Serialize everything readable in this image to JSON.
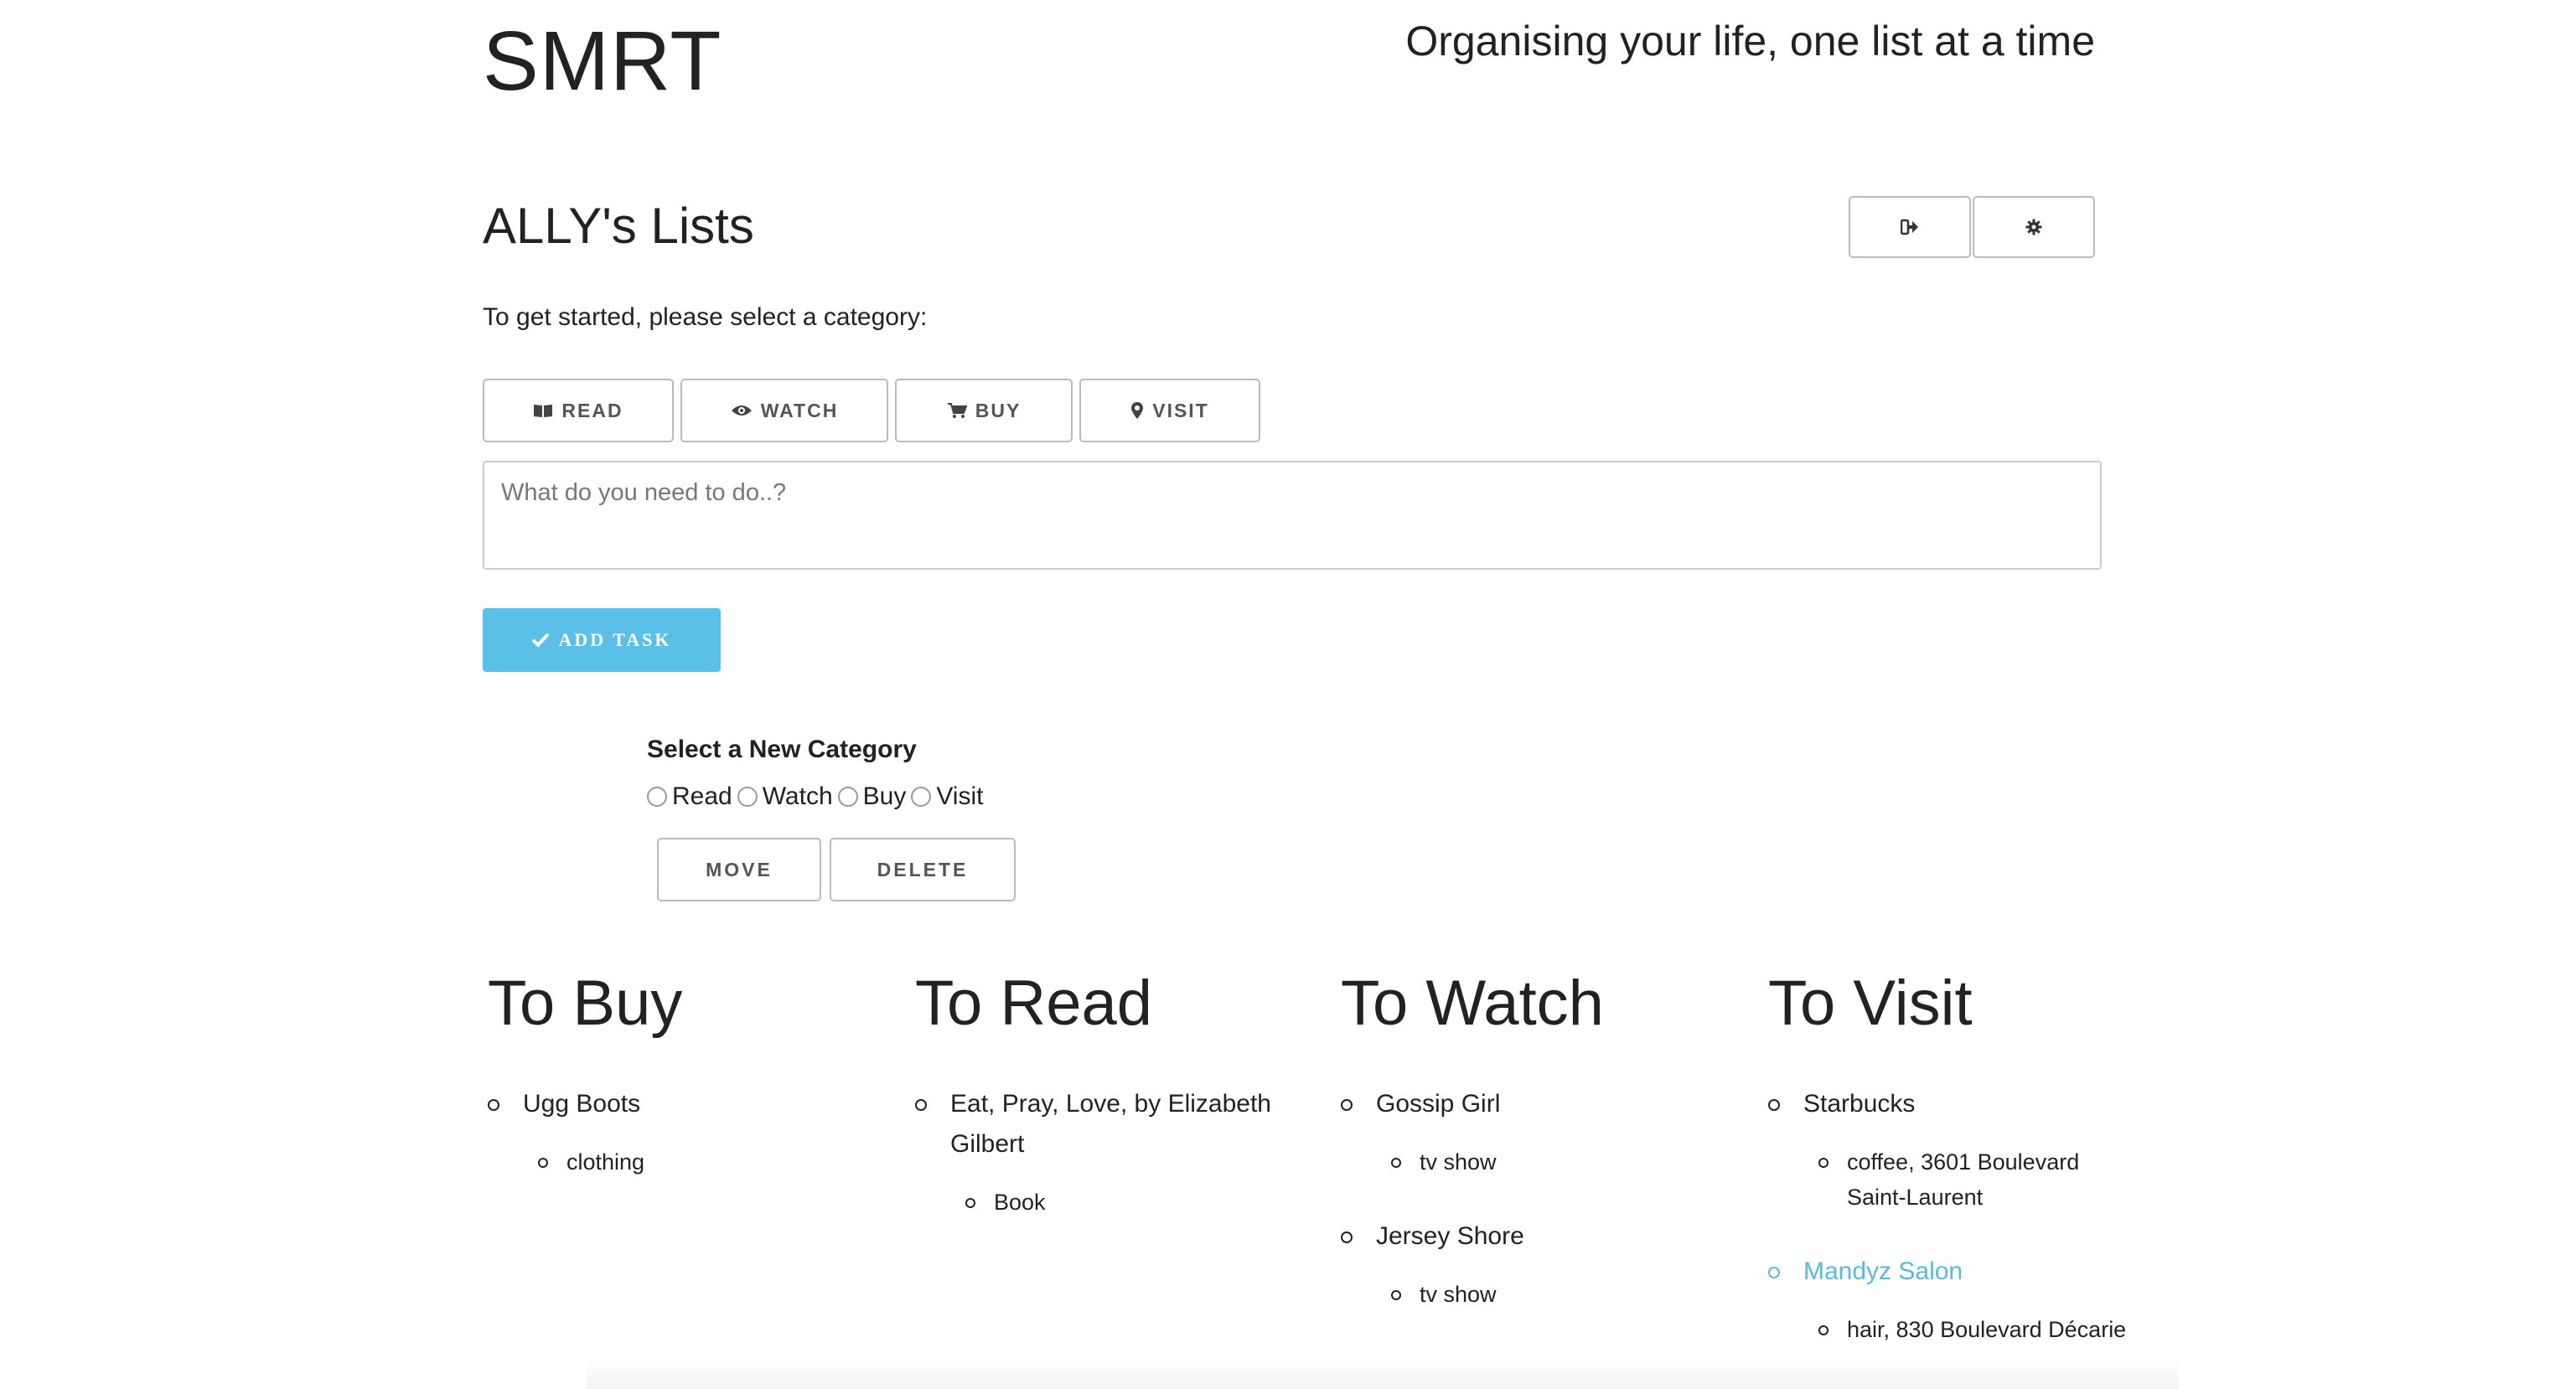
{
  "header": {
    "brand": "SMRT",
    "tagline": "Organising your life, one list at a time"
  },
  "lists": {
    "title": "ALLY's Lists",
    "icons": [
      "sign-out-icon",
      "gear-icon"
    ]
  },
  "intro": "To get started, please select a category:",
  "categories": [
    {
      "label": "READ",
      "icon": "book-icon"
    },
    {
      "label": "WATCH",
      "icon": "eye-icon"
    },
    {
      "label": "BUY",
      "icon": "cart-icon"
    },
    {
      "label": "VISIT",
      "icon": "map-marker-icon"
    }
  ],
  "task_input": {
    "placeholder": "What do you need to do..?",
    "value": ""
  },
  "add_button": "ADD TASK",
  "new_category": {
    "title": "Select a New Category",
    "options": [
      "Read",
      "Watch",
      "Buy",
      "Visit"
    ],
    "move": "MOVE",
    "delete": "DELETE"
  },
  "columns": [
    {
      "title": "To Buy",
      "items": [
        {
          "name": "Ugg Boots",
          "note": "clothing",
          "link": false
        }
      ]
    },
    {
      "title": "To Read",
      "items": [
        {
          "name": "Eat, Pray, Love, by Elizabeth Gilbert",
          "note": "Book",
          "link": false
        }
      ]
    },
    {
      "title": "To Watch",
      "items": [
        {
          "name": "Gossip Girl",
          "note": "tv show",
          "link": false
        },
        {
          "name": "Jersey Shore",
          "note": "tv show",
          "link": false
        }
      ]
    },
    {
      "title": "To Visit",
      "items": [
        {
          "name": "Starbucks",
          "note": "coffee, 3601 Boulevard Saint-Laurent",
          "link": false
        },
        {
          "name": "Mandyz Salon",
          "note": "hair, 830 Boulevard Décarie",
          "link": true
        }
      ]
    }
  ],
  "colors": {
    "accent": "#5bc0e8",
    "link": "#5bb8e0",
    "border": "#bbbbbb",
    "text": "#222222"
  }
}
